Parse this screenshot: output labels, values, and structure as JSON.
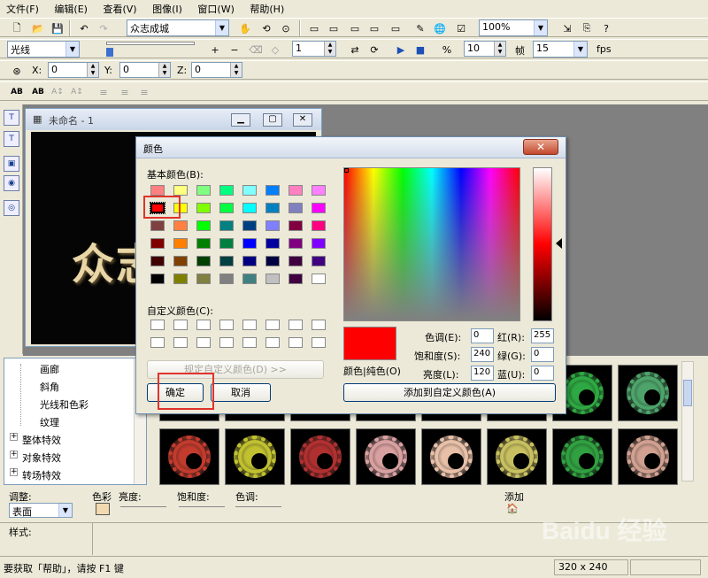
{
  "menubar": [
    "文件(F)",
    "编辑(E)",
    "查看(V)",
    "图像(I)",
    "窗口(W)",
    "帮助(H)"
  ],
  "toolbar1": {
    "text_combo": "众志成城",
    "zoom": "100%"
  },
  "toolbar2": {
    "effect_combo": "光线",
    "spin1": "1",
    "spin2": "10",
    "frame_label": "帧",
    "fps_value": "15",
    "fps_label": "fps"
  },
  "toolbar3": {
    "x_label": "X:",
    "x_value": "0",
    "y_label": "Y:",
    "y_value": "0",
    "z_label": "Z:",
    "z_value": "0"
  },
  "canvas_window": {
    "title": "未命名 - 1",
    "text": "众志"
  },
  "tree": {
    "items": [
      "画廊",
      "斜角",
      "光线和色彩",
      "纹理",
      "整体特效",
      "对象特效",
      "转场特效"
    ]
  },
  "gallery": {
    "colors": [
      "#3a5ea8",
      "#7a3c8c",
      "#8e8e8e",
      "#2b49c9",
      "#5c60c8",
      "#8aa4c0",
      "#2ea842",
      "#4da36a",
      "#c23b2d",
      "#c0c030",
      "#b03030",
      "#d8a0a0",
      "#e8c0a8",
      "#c8c060",
      "#30a040",
      "#d0a090"
    ]
  },
  "adjust": {
    "adjust_label": "调整:",
    "adjust_value": "表面",
    "color_label": "色彩",
    "brightness_label": "亮度:",
    "saturation_label": "饱和度:",
    "hue_label": "色调:",
    "add_label": "添加"
  },
  "style": {
    "label": "样式:"
  },
  "status": {
    "help_text": "要获取「帮助」，请按 F1 键",
    "size": "320 x 240"
  },
  "watermark": "Baidu 经验",
  "dialog": {
    "title": "颜色",
    "close": "✕",
    "basic_colors_label": "基本颜色(B):",
    "basic_colors": [
      [
        "#ff8080",
        "#ffff80",
        "#80ff80",
        "#00ff80",
        "#80ffff",
        "#0080ff",
        "#ff80c0",
        "#ff80ff"
      ],
      [
        "#ff0000",
        "#ffff00",
        "#80ff00",
        "#00ff40",
        "#00ffff",
        "#0080c0",
        "#8080c0",
        "#ff00ff"
      ],
      [
        "#804040",
        "#ff8040",
        "#00ff00",
        "#008080",
        "#004080",
        "#8080ff",
        "#800040",
        "#ff0080"
      ],
      [
        "#800000",
        "#ff8000",
        "#008000",
        "#008040",
        "#0000ff",
        "#0000a0",
        "#800080",
        "#8000ff"
      ],
      [
        "#400000",
        "#804000",
        "#004000",
        "#004040",
        "#000080",
        "#000040",
        "#400040",
        "#400080"
      ],
      [
        "#000000",
        "#808000",
        "#808040",
        "#808080",
        "#408080",
        "#c0c0c0",
        "#400040",
        "#ffffff"
      ]
    ],
    "custom_colors_label": "自定义颜色(C):",
    "define_custom_button": "规定自定义颜色(D) >>",
    "ok_button": "确定",
    "cancel_button": "取消",
    "color_solid_label": "颜色|纯色(O)",
    "hue_label": "色调(E):",
    "hue_value": "0",
    "sat_label": "饱和度(S):",
    "sat_value": "240",
    "lum_label": "亮度(L):",
    "lum_value": "120",
    "red_label": "红(R):",
    "red_value": "255",
    "green_label": "绿(G):",
    "green_value": "0",
    "blue_label": "蓝(U):",
    "blue_value": "0",
    "add_custom_button": "添加到自定义颜色(A)",
    "selected_color": "#ff0000"
  }
}
